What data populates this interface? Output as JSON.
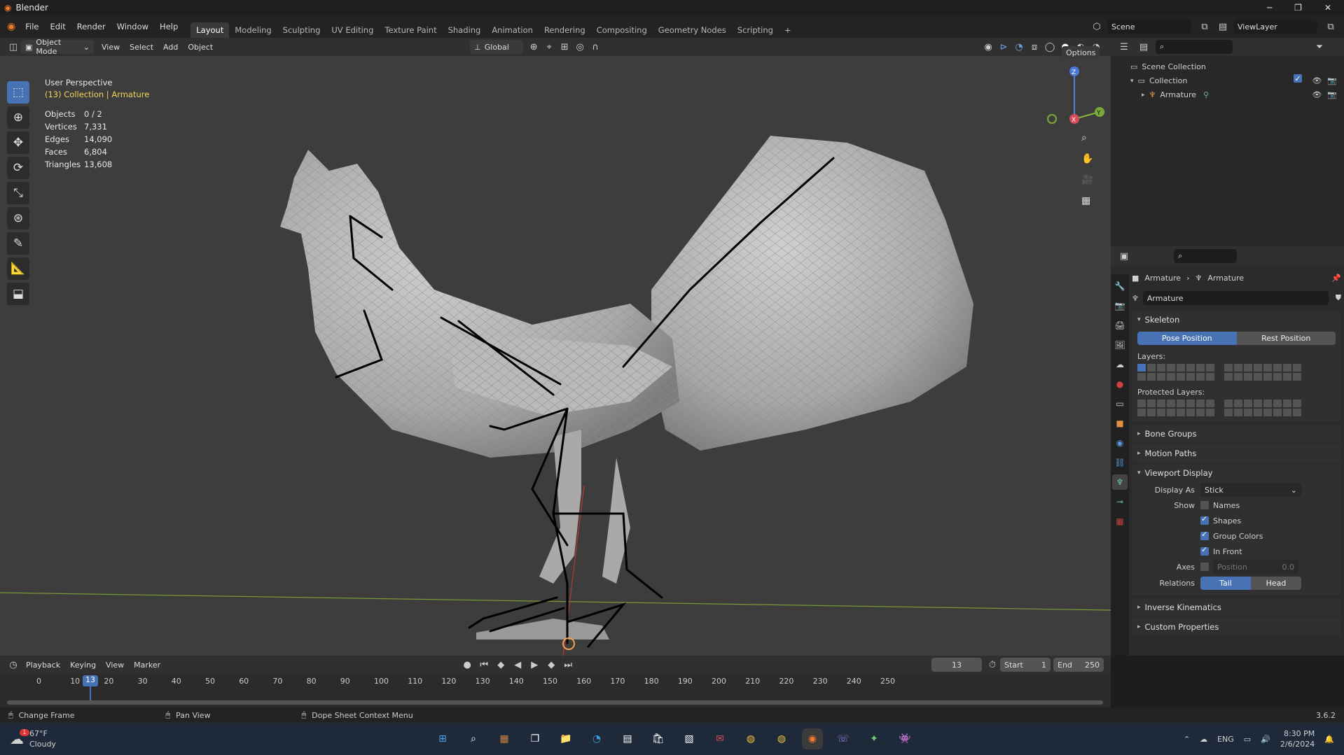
{
  "window": {
    "title": "Blender",
    "min": "─",
    "max": "❐",
    "close": "✕"
  },
  "menu": [
    "File",
    "Edit",
    "Render",
    "Window",
    "Help"
  ],
  "workspaces": [
    "Layout",
    "Modeling",
    "Sculpting",
    "UV Editing",
    "Texture Paint",
    "Shading",
    "Animation",
    "Rendering",
    "Compositing",
    "Geometry Nodes",
    "Scripting",
    "+"
  ],
  "scene": {
    "name": "Scene",
    "view_layer": "ViewLayer"
  },
  "viewport_header": {
    "mode": "Object Mode",
    "links": [
      "View",
      "Select",
      "Add",
      "Object"
    ],
    "orientation": "Global",
    "options": "Options"
  },
  "overlay_info": {
    "perspective": "User Perspective",
    "context": "(13) Collection | Armature"
  },
  "stats": [
    {
      "k": "Objects",
      "v": "0 / 2"
    },
    {
      "k": "Vertices",
      "v": "7,331"
    },
    {
      "k": "Edges",
      "v": "14,090"
    },
    {
      "k": "Faces",
      "v": "6,804"
    },
    {
      "k": "Triangles",
      "v": "13,608"
    }
  ],
  "gizmo": {
    "z": "Z",
    "y": "Y",
    "x": "X"
  },
  "outliner": {
    "scene_collection": "Scene Collection",
    "collection": "Collection",
    "armature": "Armature"
  },
  "properties": {
    "breadcrumb": [
      "Armature",
      "Armature"
    ],
    "data_name": "Armature",
    "skeleton": "Skeleton",
    "pose_position": "Pose Position",
    "rest_position": "Rest Position",
    "layers": "Layers:",
    "protected_layers": "Protected Layers:",
    "bone_groups": "Bone Groups",
    "motion_paths": "Motion Paths",
    "viewport_display": "Viewport Display",
    "display_as_label": "Display As",
    "display_as_value": "Stick",
    "show_label": "Show",
    "show_names": "Names",
    "show_shapes": "Shapes",
    "show_group_colors": "Group Colors",
    "show_in_front": "In Front",
    "axes_label": "Axes",
    "axes_position": "Position",
    "axes_value": "0.0",
    "relations_label": "Relations",
    "relations_tail": "Tail",
    "relations_head": "Head",
    "inverse_kinematics": "Inverse Kinematics",
    "custom_properties": "Custom Properties"
  },
  "timeline": {
    "menus": [
      "Playback",
      "Keying",
      "View",
      "Marker"
    ],
    "current_frame": "13",
    "start_label": "Start",
    "start": "1",
    "end_label": "End",
    "end": "250",
    "ticks": [
      "0",
      "10",
      "20",
      "30",
      "40",
      "50",
      "60",
      "70",
      "80",
      "90",
      "100",
      "110",
      "120",
      "130",
      "140",
      "150",
      "160",
      "170",
      "180",
      "190",
      "200",
      "210",
      "220",
      "230",
      "240",
      "250"
    ],
    "playhead_label": "13"
  },
  "statusbar": {
    "change_frame": "Change Frame",
    "pan_view": "Pan View",
    "context_menu": "Dope Sheet Context Menu",
    "version": "3.6.2"
  },
  "taskbar": {
    "weather_temp": "67°F",
    "weather_desc": "Cloudy",
    "weather_badge": "1",
    "lang": "ENG",
    "time": "8:30 PM",
    "date": "2/6/2024"
  },
  "colors": {
    "accent": "#4772b3",
    "viewport_bg": "#3d3d3d",
    "panel_bg": "#2b2b2b",
    "context_yellow": "#f5d35a"
  }
}
